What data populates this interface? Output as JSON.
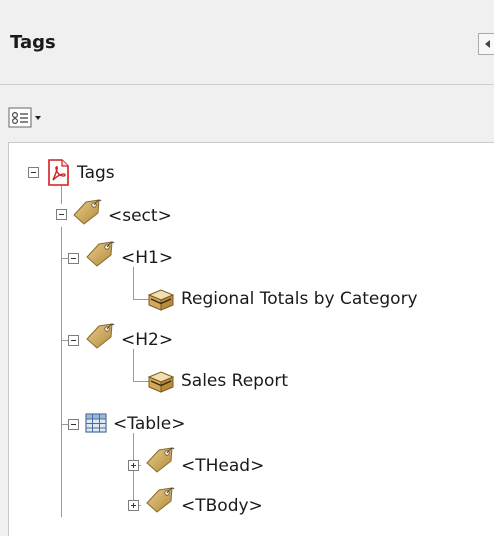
{
  "panel": {
    "title": "Tags",
    "collapse_icon": "collapse-left-icon",
    "options_icon": "tag-options-icon"
  },
  "tree": {
    "root": {
      "label": "Tags",
      "icon": "pdf-icon",
      "expanded": true
    },
    "sect": {
      "label": "<sect>",
      "icon": "tag-icon",
      "expanded": true
    },
    "h1": {
      "label": "<H1>",
      "icon": "tag-icon",
      "expanded": true
    },
    "h1_content": {
      "label": "Regional Totals by Category",
      "icon": "content-box-icon"
    },
    "h2": {
      "label": "<H2>",
      "icon": "tag-icon",
      "expanded": true
    },
    "h2_content": {
      "label": "Sales Report",
      "icon": "content-box-icon"
    },
    "table": {
      "label": "<Table>",
      "icon": "table-icon",
      "expanded": true
    },
    "thead": {
      "label": "<THead>",
      "icon": "tag-icon",
      "expanded": false
    },
    "tbody": {
      "label": "<TBody>",
      "icon": "tag-icon",
      "expanded": false
    }
  }
}
